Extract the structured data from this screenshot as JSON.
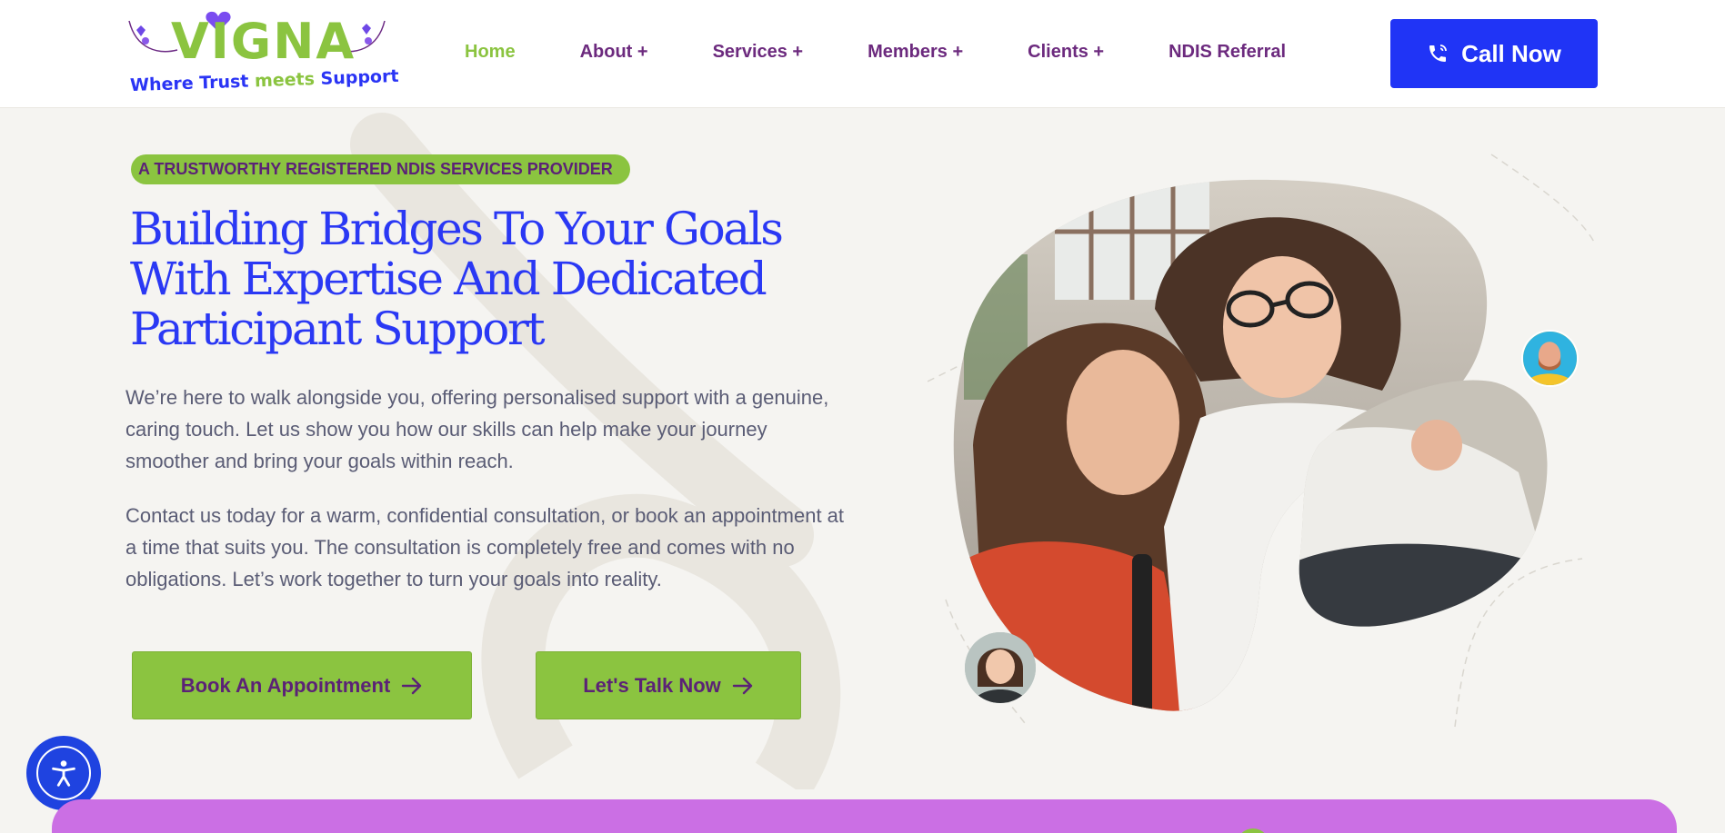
{
  "logo": {
    "word": "VIGNA",
    "tagline_part1": "Where Trust",
    "tagline_part2": "meets",
    "tagline_part3": "Support"
  },
  "nav": {
    "items": [
      {
        "label": "Home",
        "active": true
      },
      {
        "label": "About +"
      },
      {
        "label": "Services +"
      },
      {
        "label": "Members +"
      },
      {
        "label": "Clients +"
      },
      {
        "label": "NDIS Referral"
      }
    ],
    "call_label": "Call Now"
  },
  "hero": {
    "badge": "A TRUSTWORTHY REGISTERED NDIS SERVICES PROVIDER",
    "headline": "Building Bridges To Your Goals With Expertise And Dedicated Participant Support",
    "paragraph1": "We’re here to walk alongside you, offering personalised support with a genuine, caring touch. Let us show you how our skills can help make your journey smoother and bring your goals within reach.",
    "paragraph2": "Contact us today for a warm, confidential consultation, or book an appointment at a time that suits you. The consultation is completely free and comes with no obligations. Let’s work together to turn your goals into reality.",
    "book_button": "Book An Appointment",
    "talk_button": "Let's Talk Now"
  },
  "colors": {
    "brand_blue": "#2034f6",
    "brand_green": "#8bc440",
    "brand_purple": "#6c2a7e",
    "band_purple": "#cb6fe4",
    "page_bg": "#f5f4f1"
  },
  "icons": [
    "phone-icon",
    "arrow-right-icon",
    "accessibility-icon",
    "heart-icon"
  ]
}
